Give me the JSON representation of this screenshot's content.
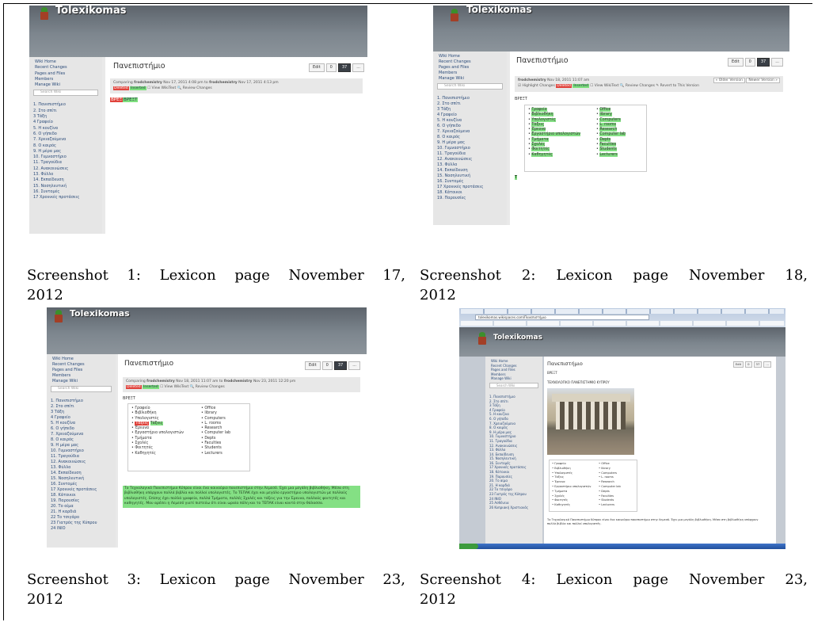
{
  "captions": [
    {
      "line1": "Screenshot 1: Lexicon page November 17,",
      "line2": "2012"
    },
    {
      "line1": "Screenshot 2: Lexicon page November 18,",
      "line2": "2012"
    },
    {
      "line1": "Screenshot 3: Lexicon page November 23,",
      "line2": "2012"
    },
    {
      "line1": "Screenshot 4: Lexicon page November 23,",
      "line2": "2012"
    }
  ],
  "wiki": {
    "name": "Tolexikomas",
    "page_title": "Πανεπιστήμιο",
    "edit": "Edit",
    "comments": "0",
    "version": "37",
    "more": "...",
    "search_placeholder": "Search Wiki",
    "nav": [
      "Wiki Home",
      "Recent Changes",
      "Pages and Files",
      "Members",
      "Manage Wiki"
    ],
    "pages": [
      "1. Πανεπιστήμιο",
      "2. Στο σπίτι",
      "3 Τάξη",
      "4 Γραφείο",
      "5. Η κουζίνα",
      "6. Ο γήπεδο",
      "7. Χρειαζούμενα",
      "8. Ο καιρός",
      "9. Η μέρα μας",
      "10. Γυμναστήριο",
      "11. Τραγούδια",
      "12. Ανακοινώσεις",
      "13. Φύλλο",
      "14. Εκπαίδευση",
      "15. Νοσηλευτική",
      "16. Συντομές",
      "17 Χρονικές προτάσεις"
    ],
    "pages_extra": [
      "18. Κάτοικοι",
      "19. Παρουσίες",
      "20. Το αίμα",
      "21. Η καρδιά",
      "22 Το τσιγάρο",
      "23 Γιατρός της Κύπρου",
      "24 ΙΝΙΟ",
      "25 Ασθένεια",
      "26 Κυπριακή Χριστιανός"
    ],
    "shot1": {
      "compare": "Comparing",
      "user": "frodchemistry",
      "date_a": "Nov 17, 2011 4:08 pm",
      "to": "to",
      "date_b": "Nov 17, 2011 4:13 pm",
      "deleted": "Deleted",
      "inserted": "Inserted",
      "view_wikitext": "View WikiText",
      "review": "Review Changes",
      "diff_deleted": "ΒΡΕΞ",
      "diff_inserted": "ΒΡΕΞΤ"
    },
    "shot2": {
      "user": "frodchemistry",
      "date": "Nov 18, 2011 11:07 am",
      "older": "« Older Version",
      "newer": "Newer Version »",
      "highlight": "Highlight Changes",
      "deleted": "Deleted",
      "inserted": "Inserted",
      "view_wikitext": "View WikiText",
      "review": "Review Changes",
      "revert": "Revert to This Version",
      "heading": "ΒΡΕΞΤ",
      "greek": [
        "Γραφείο",
        "Βιβλιοθήκη",
        "Υπολογιστές",
        "Τάξεις",
        "Έρευνα",
        "Εργαστήριο υπολογιστών",
        "Τμήματα",
        "Σχολές",
        "Φοιτητές",
        "Καθηγητές"
      ],
      "english": [
        "Office",
        "library",
        "Computers",
        "L. rooms",
        "Research",
        "Computer lab",
        "Depts",
        "Faculties",
        "Students",
        "Lecturers"
      ],
      "trailer": "T"
    },
    "shot3": {
      "compare": "Comparing",
      "user": "frodchemistry",
      "date_a": "Nov 18, 2011 11:07 am",
      "to": "to",
      "date_b": "Nov 23, 2011 12:20 pm",
      "deleted": "Deleted",
      "inserted": "Inserted",
      "view_wikitext": "View WikiText",
      "review": "Review Changes",
      "heading": "ΒΡΕΞΤ",
      "greek": [
        "Γραφείο",
        "Βιβλιοθήκη",
        "Υπολογιστές",
        "Τάξεις",
        "Έρευνα",
        "Εργαστήριο υπολογιστών",
        "Τμήματα",
        "Σχολές",
        "Φοιτητές",
        "Καθηγητές"
      ],
      "english": [
        "Office",
        "library",
        "Computers",
        "L. rooms",
        "Research",
        "Computer lab",
        "Depts",
        "Faculties",
        "Students",
        "Lecturers"
      ],
      "paragraph": "Το Τεχνολογικό Πανεπιστήμιο Κύπρου είναι ένα καινούριο πανεπιστήμιο στην Λεμεσό. Έχει μια μεγάλη βιβλιοθήκη. Μέσα στη βιβλιοθήκη υπάρχουν πολλά βιβλία και πολλοί υπολογιστές. Το ΤΕΠΑΚ έχει και μεγάλο εργαστήριο υπολογιστών με πολλούς υπολογιστές. Επίσης έχει πολλά γραφεία, πολλά Τμήματα, πολλές Σχολές και τάξεις για την Έρευνα, πολλούς φοιτητές και καθηγητές. Μου αρέσει η Λεμεσό γιατί πιστεύω ότι είναι ωραία πόλη και το ΤΕΠΑΚ είναι κοντά στην θάλασσα."
    },
    "shot4": {
      "heading": "ΒΡΕΞΤ",
      "subheading": "ΤΕΧΝΟΛΟΓΙΚΟ ΠΑΝΕΠΙΣΤΗΜΙΟ ΚΥΠΡΟΥ",
      "url": "tolexikomas.wikispaces.com/Πανεπιστήμιο",
      "greek": [
        "Γραφείο",
        "Βιβλιοθήκη",
        "Υπολογιστές",
        "Τάξεις",
        "Έρευνα",
        "Εργαστήριο υπολογιστών",
        "Τμήματα",
        "Σχολές",
        "Φοιτητές",
        "Καθηγητές"
      ],
      "english": [
        "Office",
        "library",
        "Computers",
        "L. rooms",
        "Research",
        "Computer lab",
        "Depts",
        "Faculties",
        "Students",
        "Lecturers"
      ],
      "paragraph": "Το Τεχνολογικό Πανεπιστήμιο Κύπρου είναι ένα καινούριο πανεπιστήμιο στην Λεμεσό. Έχει μια μεγάλη βιβλιοθήκη. Μέσα στη βιβλιοθήκη υπάρχουν πολλά βιβλία και πολλοί υπολογιστές."
    }
  }
}
